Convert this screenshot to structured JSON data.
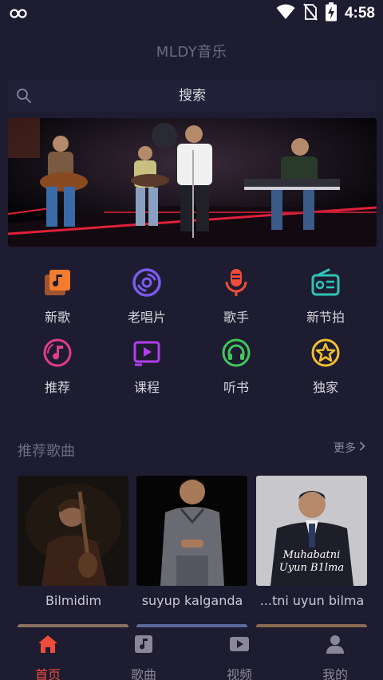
{
  "status_bar": {
    "time": "4:58",
    "icons": [
      "infinity-icon",
      "wifi-icon",
      "no-sim-icon",
      "battery-charging-icon"
    ]
  },
  "app": {
    "title": "MLDY音乐"
  },
  "search": {
    "placeholder": "搜索",
    "icon": "search-icon"
  },
  "banner": {
    "alt": "band-performance-photo"
  },
  "quick_menu": [
    {
      "label": "新歌",
      "icon": "music-library-icon",
      "color": "#f47b2e"
    },
    {
      "label": "老唱片",
      "icon": "vinyl-record-icon",
      "color": "#7b5cf0"
    },
    {
      "label": "歌手",
      "icon": "microphone-icon",
      "color": "#f04c3a"
    },
    {
      "label": "新节拍",
      "icon": "radio-icon",
      "color": "#2ec4b6"
    },
    {
      "label": "推荐",
      "icon": "music-note-circle-icon",
      "color": "#e23c8a"
    },
    {
      "label": "课程",
      "icon": "play-box-icon",
      "color": "#b23ef0"
    },
    {
      "label": "听书",
      "icon": "headphones-icon",
      "color": "#3fc85a"
    },
    {
      "label": "独家",
      "icon": "star-circle-icon",
      "color": "#f0c02e"
    }
  ],
  "recommended": {
    "title": "推荐歌曲",
    "more_label": "更多",
    "songs": [
      {
        "title": "Bilmidim"
      },
      {
        "title": "suyup kalganda"
      },
      {
        "title": "...tni uyun bilma",
        "cover_text_line1": "Muhabatni",
        "cover_text_line2": "Uyun B1lma"
      }
    ]
  },
  "tabbar": {
    "tabs": [
      {
        "label": "首页",
        "icon": "home-icon",
        "active": true
      },
      {
        "label": "歌曲",
        "icon": "music-note-icon",
        "active": false
      },
      {
        "label": "视频",
        "icon": "video-play-icon",
        "active": false
      },
      {
        "label": "我的",
        "icon": "user-icon",
        "active": false
      }
    ]
  },
  "colors": {
    "background": "#1e1c30",
    "accent": "#f04c3a",
    "muted_text": "#6c6a80"
  }
}
